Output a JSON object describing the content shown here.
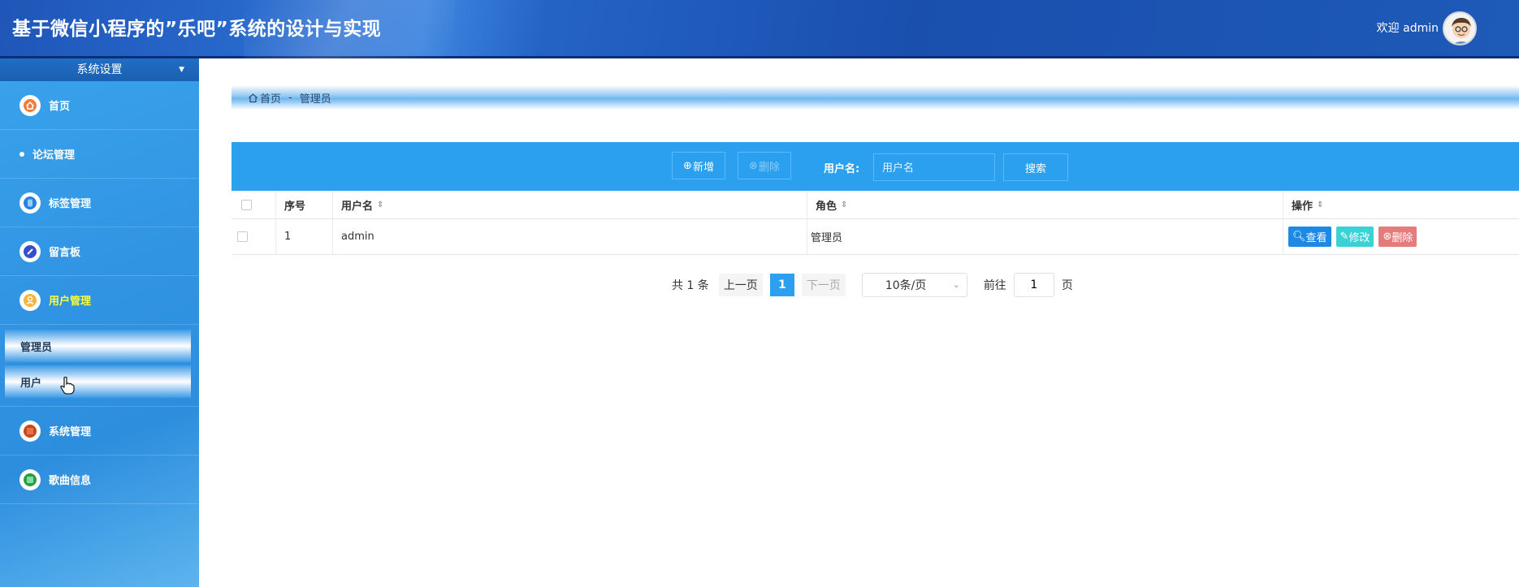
{
  "header": {
    "title": "基于微信小程序的”乐吧”系统的设计与实现",
    "welcome": "欢迎 admin"
  },
  "sidebar": {
    "section_title": "系统设置",
    "items": [
      {
        "label": "首页",
        "icon": "home-icon"
      },
      {
        "label": "论坛管理",
        "icon": "dot-icon"
      },
      {
        "label": "标签管理",
        "icon": "tag-icon"
      },
      {
        "label": "留言板",
        "icon": "message-icon"
      },
      {
        "label": "用户管理",
        "icon": "user-icon",
        "active": true
      },
      {
        "label": "系统管理",
        "icon": "system-icon"
      },
      {
        "label": "歌曲信息",
        "icon": "music-icon"
      }
    ],
    "user_submenu": [
      {
        "label": "管理员"
      },
      {
        "label": "用户"
      }
    ]
  },
  "breadcrumb": {
    "home": "首页",
    "separator": "-",
    "current": "管理员"
  },
  "toolbar": {
    "add_label": "新增",
    "delete_label": "删除",
    "username_label": "用户名:",
    "username_placeholder": "用户名",
    "search_label": "搜索"
  },
  "table": {
    "columns": [
      "序号",
      "用户名",
      "角色",
      "操作"
    ],
    "rows": [
      {
        "index": "1",
        "username": "admin",
        "role": "管理员"
      }
    ],
    "actions": {
      "view": "查看",
      "edit": "修改",
      "delete": "删除"
    }
  },
  "pagination": {
    "total": "共 1 条",
    "prev": "上一页",
    "current": "1",
    "next": "下一页",
    "page_size": "10条/页",
    "goto_label": "前往",
    "goto_value": "1",
    "page_suffix": "页"
  },
  "colors": {
    "primary": "#2aa0ee",
    "active_menu": "#ffff33",
    "view_btn": "#1e88e5",
    "edit_btn": "#3ad2d6",
    "delete_btn": "#e57b7b"
  }
}
